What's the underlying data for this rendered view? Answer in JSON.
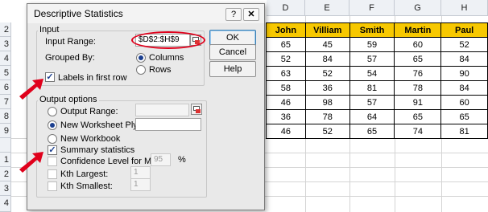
{
  "sheet": {
    "columns": [
      "D",
      "E",
      "F",
      "G",
      "H"
    ],
    "rows": [
      "2",
      "3",
      "4",
      "5",
      "6",
      "7",
      "8",
      "9",
      "",
      "1",
      "2",
      "3",
      "4"
    ],
    "table": {
      "headers": [
        "John",
        "Villiam",
        "Smith",
        "Martin",
        "Paul"
      ],
      "rows": [
        [
          "65",
          "45",
          "59",
          "60",
          "52"
        ],
        [
          "52",
          "84",
          "57",
          "65",
          "84"
        ],
        [
          "63",
          "52",
          "54",
          "76",
          "90"
        ],
        [
          "58",
          "36",
          "81",
          "78",
          "84"
        ],
        [
          "46",
          "98",
          "57",
          "91",
          "60"
        ],
        [
          "36",
          "78",
          "64",
          "65",
          "65"
        ],
        [
          "46",
          "52",
          "65",
          "74",
          "81"
        ]
      ]
    }
  },
  "dialog": {
    "title": "Descriptive Statistics",
    "help_glyph": "?",
    "close_glyph": "✕",
    "input_group": {
      "label": "Input",
      "input_range_label": "Input Range:",
      "input_range_value": "$D$2:$H$9",
      "grouped_by_label": "Grouped By:",
      "columns_label": "Columns",
      "rows_label": "Rows",
      "labels_first_row": "Labels in first row"
    },
    "output_group": {
      "label": "Output options",
      "output_range_label": "Output Range:",
      "new_ply_label": "New Worksheet Ply:",
      "new_workbook_label": "New Workbook",
      "summary_label": "Summary statistics",
      "confidence_label": "Confidence Level for Mean:",
      "confidence_value": "95",
      "percent": "%",
      "kth_largest_label": "Kth Largest:",
      "kth_largest_value": "1",
      "kth_smallest_label": "Kth Smallest:",
      "kth_smallest_value": "1"
    },
    "buttons": {
      "ok": "OK",
      "cancel": "Cancel",
      "help": "Help"
    },
    "check_glyph": "✓"
  },
  "colors": {
    "highlight": "#e0001b",
    "header_fill": "#f7c800"
  }
}
